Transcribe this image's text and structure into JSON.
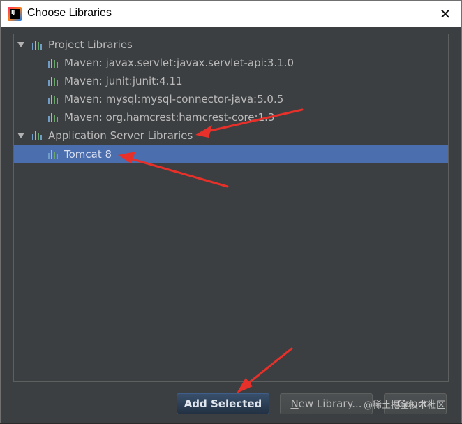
{
  "window": {
    "title": "Choose Libraries",
    "close_glyph": "✕"
  },
  "tree": {
    "groups": [
      {
        "label": "Project Libraries",
        "expanded": true,
        "items": [
          "Maven: javax.servlet:javax.servlet-api:3.1.0",
          "Maven: junit:junit:4.11",
          "Maven: mysql:mysql-connector-java:5.0.5",
          "Maven: org.hamcrest:hamcrest-core:1.3"
        ]
      },
      {
        "label": "Application Server Libraries",
        "expanded": true,
        "items": [
          "Tomcat 8"
        ]
      }
    ],
    "selected_item": "Tomcat 8"
  },
  "buttons": {
    "add_selected": "Add Selected",
    "new_library": "New Library...",
    "cancel": "Cancel"
  },
  "watermark": "@稀土掘金技术社区",
  "colors": {
    "selection": "#4b6eaf",
    "annotation_arrow": "#e8302a",
    "library_icon": [
      "#6f9dc8",
      "#d7b444",
      "#6aa76a",
      "#6f9dc8"
    ]
  },
  "icons": {
    "expand": "triangle-down-icon",
    "library": "library-bars-icon",
    "app": "intellij-idea-icon"
  }
}
